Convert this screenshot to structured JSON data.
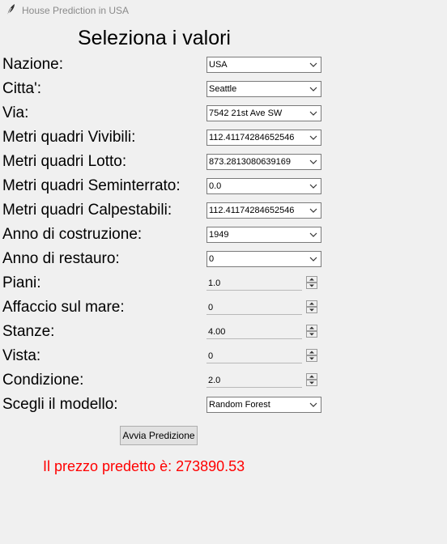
{
  "window": {
    "title": "House Prediction in USA",
    "icon": "feather-icon"
  },
  "heading": "Seleziona i valori",
  "fields": [
    {
      "label": "Nazione:",
      "type": "combo",
      "value": "USA"
    },
    {
      "label": "Citta':",
      "type": "combo",
      "value": "Seattle"
    },
    {
      "label": "Via:",
      "type": "combo",
      "value": "7542 21st Ave SW"
    },
    {
      "label": "Metri quadri Vivibili:",
      "type": "combo",
      "value": "112.41174284652546"
    },
    {
      "label": "Metri quadri Lotto:",
      "type": "combo",
      "value": "873.2813080639169"
    },
    {
      "label": "Metri quadri Seminterrato:",
      "type": "combo",
      "value": "0.0"
    },
    {
      "label": "Metri quadri Calpestabili:",
      "type": "combo",
      "value": "112.41174284652546"
    },
    {
      "label": "Anno di costruzione:",
      "type": "combo",
      "value": "1949"
    },
    {
      "label": "Anno di restauro:",
      "type": "combo",
      "value": "0"
    },
    {
      "label": "Piani:",
      "type": "spin",
      "value": "1.0"
    },
    {
      "label": "Affaccio sul mare:",
      "type": "spin",
      "value": "0"
    },
    {
      "label": "Stanze:",
      "type": "spin",
      "value": "4.00"
    },
    {
      "label": "Vista:",
      "type": "spin",
      "value": "0"
    },
    {
      "label": "Condizione:",
      "type": "spin",
      "value": "2.0"
    },
    {
      "label": "Scegli il modello:",
      "type": "combo",
      "value": "Random Forest"
    }
  ],
  "predict_button": "Avvia Predizione",
  "result": "Il prezzo predetto è: 273890.53",
  "colors": {
    "background": "#f0f0f0",
    "result_text": "#ff0000",
    "title_text": "#8a8a8a"
  }
}
